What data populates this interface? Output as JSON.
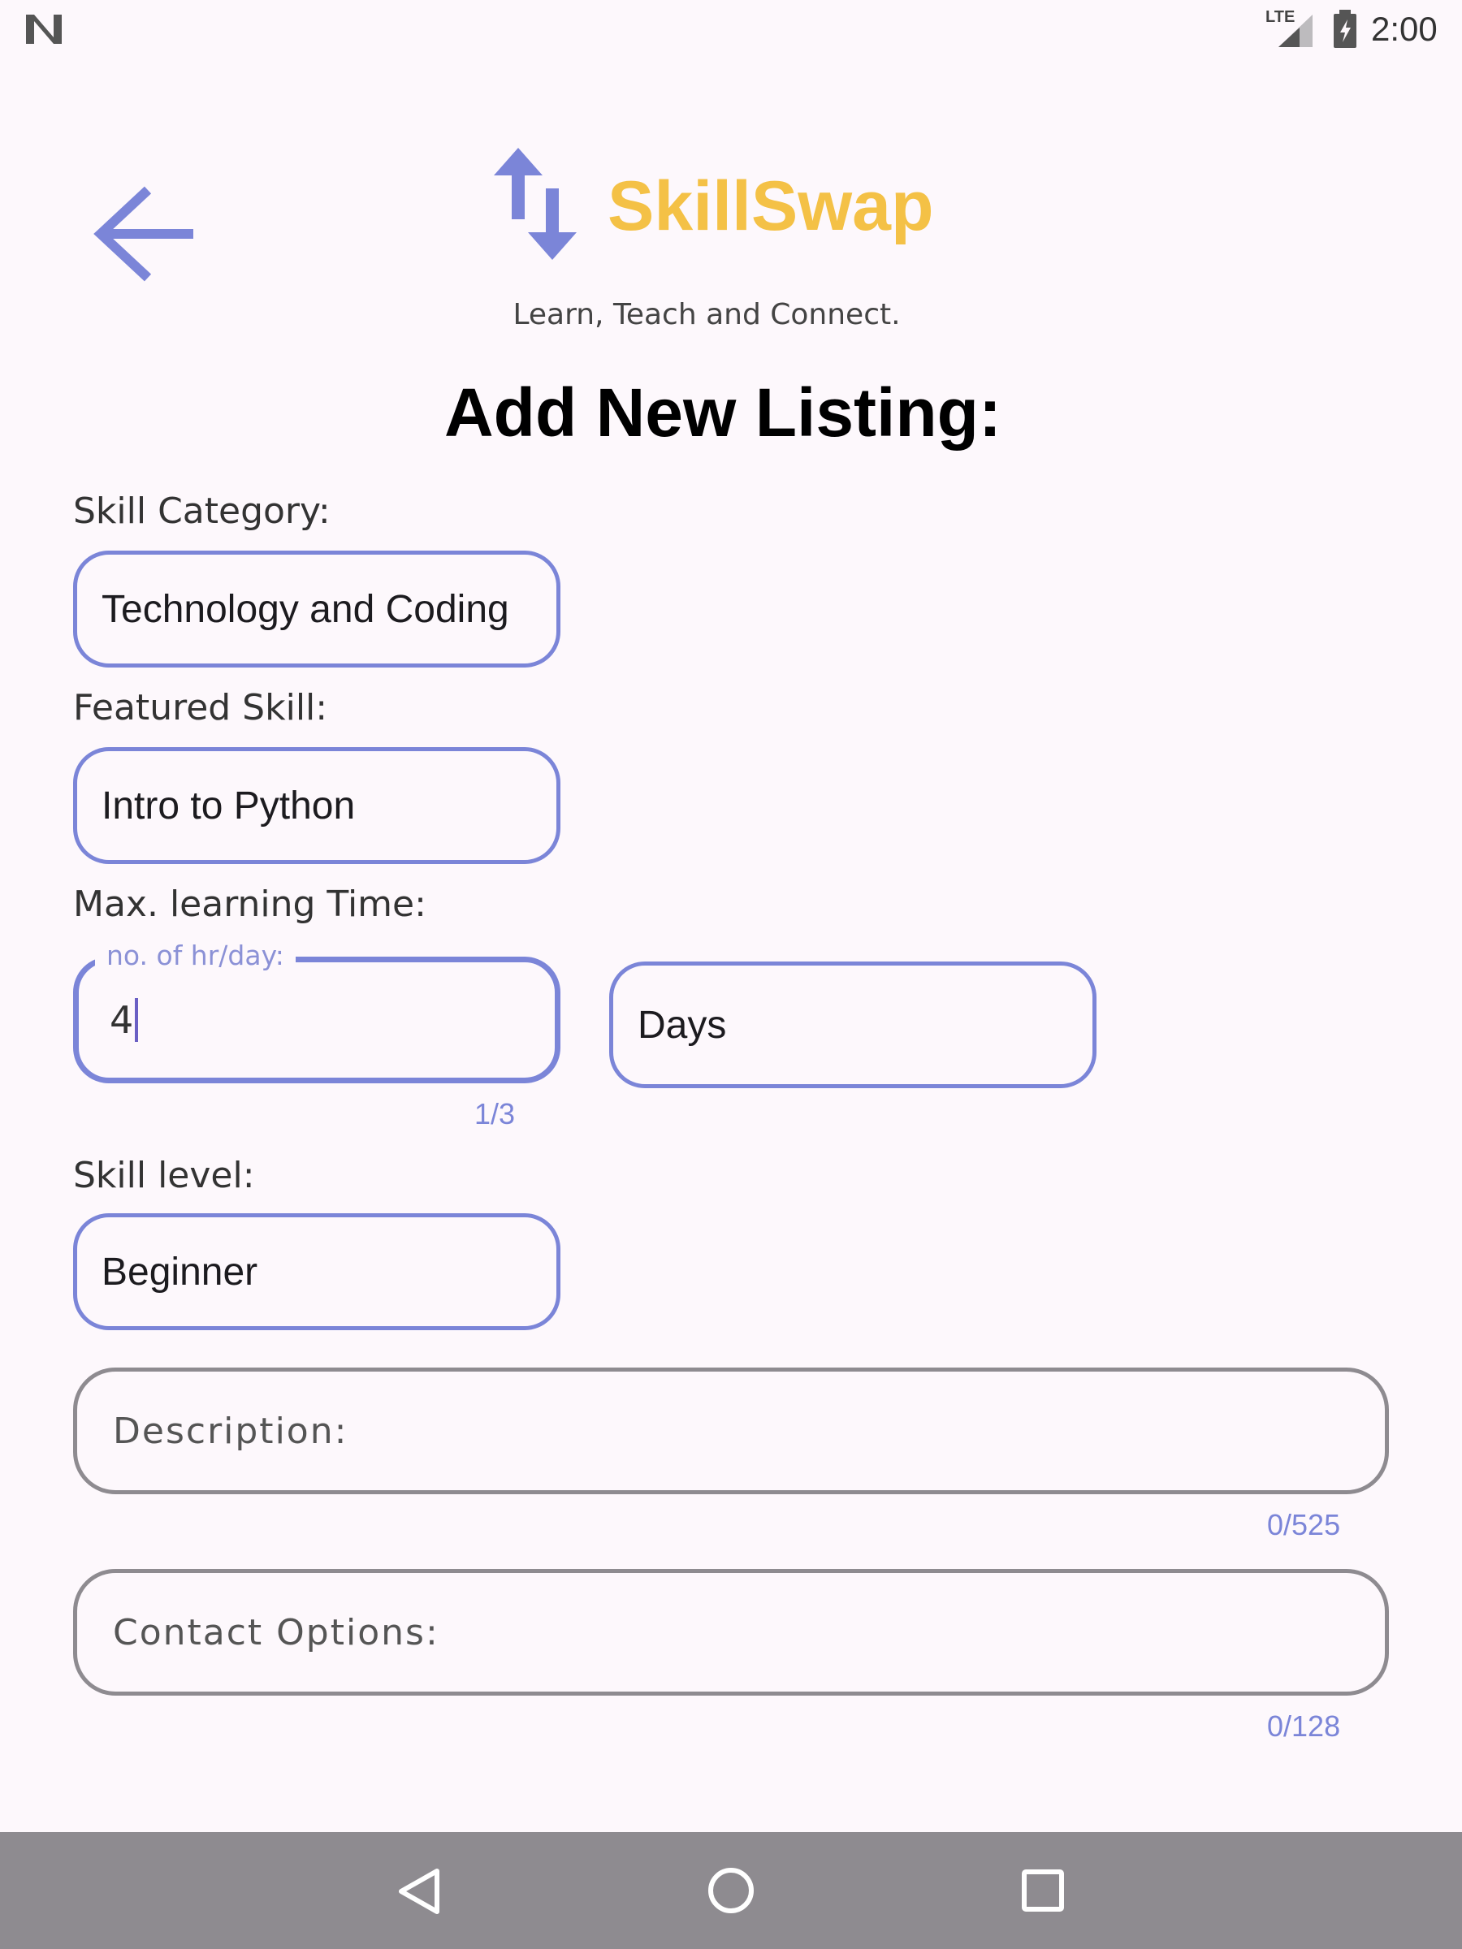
{
  "status_bar": {
    "time": "2:00",
    "network": "LTE",
    "icons": [
      "notification-n-icon",
      "lte-signal-icon",
      "battery-charging-icon"
    ]
  },
  "header": {
    "back_icon": "arrow-left-icon",
    "logo_icon": "swap-arrows-icon",
    "brand": "SkillSwap",
    "tagline": "Learn, Teach and Connect.",
    "title": "Add New Listing:"
  },
  "form": {
    "skill_category": {
      "label": "Skill Category:",
      "value": "Technology and Coding"
    },
    "featured_skill": {
      "label": "Featured Skill:",
      "value": "Intro to Python"
    },
    "max_learning_time": {
      "label": "Max. learning Time:",
      "hours_label": "no. of hr/day:",
      "hours_value": "4",
      "hours_counter": "1/3",
      "unit_value": "Days"
    },
    "skill_level": {
      "label": "Skill level:",
      "value": "Beginner"
    },
    "description": {
      "placeholder": "Description:",
      "counter": "0/525"
    },
    "contact_options": {
      "placeholder": "Contact Options:",
      "counter": "0/128"
    }
  },
  "nav_bar": {
    "icons": [
      "back-triangle-icon",
      "home-circle-icon",
      "recents-square-icon"
    ]
  },
  "colors": {
    "accent": "#7b85d8",
    "brand": "#f4c146",
    "background": "#fdf8fc",
    "nav_bar": "#8e8b90"
  }
}
